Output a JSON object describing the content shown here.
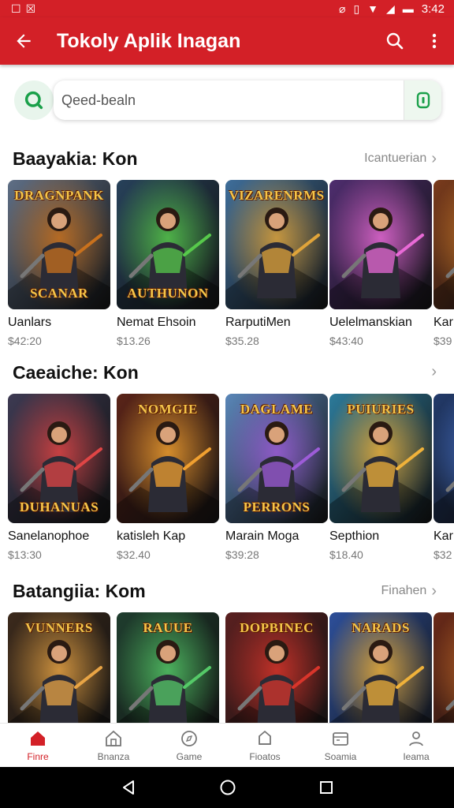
{
  "status_bar": {
    "time": "3:42",
    "left_icons": [
      "notification-icon",
      "notification-icon"
    ],
    "right_icons": [
      "data-icon",
      "vibrate-icon",
      "wifi-icon",
      "signal-icon",
      "battery-icon"
    ]
  },
  "app_bar": {
    "title": "Tokoly Aplik Inagan",
    "icons": [
      "back-arrow-icon",
      "search-icon",
      "more-vert-icon"
    ]
  },
  "search": {
    "placeholder": "Qeed-bealn"
  },
  "sections": [
    {
      "title": "Baayakia: Kon",
      "more_label": "Icantuerian",
      "items": [
        {
          "name": "Uanlars",
          "price": "$42:20",
          "art_top": "DRAGNPANK",
          "art_bottom": "SCANAR",
          "accent": "#c9711d",
          "bg": "#5f6f86"
        },
        {
          "name": "Nemat Ehsoin",
          "price": "$13.26",
          "art_top": "",
          "art_bottom": "AUTHUNON",
          "accent": "#57c94b",
          "bg": "#27415a"
        },
        {
          "name": "RarputiMen",
          "price": "$35.28",
          "art_top": "VIZARENRMS",
          "art_bottom": "",
          "accent": "#e0a43a",
          "bg": "#3f6e9a"
        },
        {
          "name": "Uelelmanskian",
          "price": "$43:40",
          "art_top": "",
          "art_bottom": "",
          "accent": "#e86ad6",
          "bg": "#4e2d6e"
        },
        {
          "name": "Kar",
          "price": "$39",
          "art_top": "",
          "art_bottom": "",
          "accent": "#e58a2c",
          "bg": "#7a3b1c"
        }
      ]
    },
    {
      "title": "Caeaiche: Kon",
      "more_label": "",
      "items": [
        {
          "name": "Sanelanophoe",
          "price": "$13:30",
          "art_top": "",
          "art_bottom": "DUHANUAS",
          "accent": "#e04545",
          "bg": "#3d3a52"
        },
        {
          "name": "katisleh Kap",
          "price": "$32.40",
          "art_top": "NOMGIE",
          "art_bottom": "",
          "accent": "#f0a030",
          "bg": "#5a2418"
        },
        {
          "name": "Marain Moga",
          "price": "$39:28",
          "art_top": "DAGLAME",
          "art_bottom": "PERRONS",
          "accent": "#9d5cd8",
          "bg": "#5a86b8"
        },
        {
          "name": "Septhion",
          "price": "$18.40",
          "art_top": "PUIURIES",
          "art_bottom": "",
          "accent": "#f0b23a",
          "bg": "#2c7a9a"
        },
        {
          "name": "Kar",
          "price": "$32",
          "art_top": "",
          "art_bottom": "",
          "accent": "#4d7de0",
          "bg": "#223a6a"
        }
      ]
    },
    {
      "title": "Batangiia: Kom",
      "more_label": "Finahen",
      "items": [
        {
          "name": "",
          "price": "",
          "art_top": "VUNNERS",
          "art_bottom": "",
          "accent": "#e8a445",
          "bg": "#3c2a1c"
        },
        {
          "name": "",
          "price": "",
          "art_top": "RAUUE",
          "art_bottom": "",
          "accent": "#55c968",
          "bg": "#1f3d2e"
        },
        {
          "name": "",
          "price": "",
          "art_top": "DOPBINEC",
          "art_bottom": "",
          "accent": "#d8352b",
          "bg": "#5a2020"
        },
        {
          "name": "",
          "price": "",
          "art_top": "NARADS",
          "art_bottom": "",
          "accent": "#f0b23a",
          "bg": "#2d4f9a"
        },
        {
          "name": "",
          "price": "",
          "art_top": "",
          "art_bottom": "",
          "accent": "#e07a2c",
          "bg": "#6a2a18"
        }
      ]
    }
  ],
  "bottom_nav": [
    {
      "label": "Finre",
      "icon": "home-icon",
      "active": true
    },
    {
      "label": "Bnanza",
      "icon": "building-icon",
      "active": false
    },
    {
      "label": "Game",
      "icon": "compass-icon",
      "active": false
    },
    {
      "label": "Fioatos",
      "icon": "tag-icon",
      "active": false
    },
    {
      "label": "Soamia",
      "icon": "wallet-icon",
      "active": false
    },
    {
      "label": "Ieama",
      "icon": "profile-icon",
      "active": false
    }
  ],
  "system_nav": [
    "back-icon",
    "home-circle-icon",
    "recents-icon"
  ],
  "colors": {
    "brand_red": "#d32027",
    "search_green": "#1aa04a"
  }
}
